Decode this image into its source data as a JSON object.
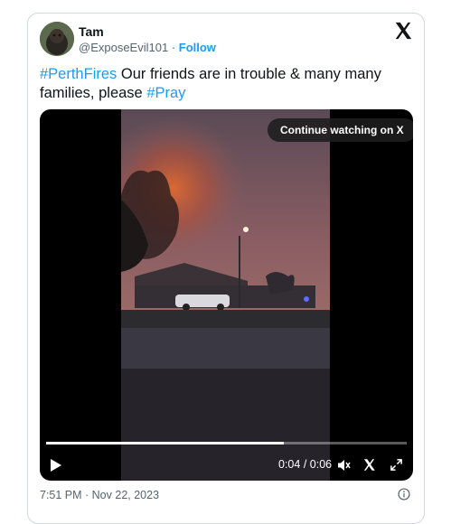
{
  "author": {
    "display_name": "Tam",
    "handle": "@ExposeEvil101",
    "separator": " · ",
    "follow_label": "Follow"
  },
  "tweet": {
    "hashtag1": "#PerthFires",
    "text1": " Our friends are in trouble & many many families, please ",
    "hashtag2": "#Pray"
  },
  "video": {
    "continue_label": "Continue watching on X",
    "time_current": "0:04",
    "time_separator": " / ",
    "time_total": "0:06",
    "progress": 0.66
  },
  "meta": {
    "timestamp": "7:51 PM · Nov 22, 2023"
  },
  "colors": {
    "accent": "#1d9bf0",
    "text": "#0f1419",
    "muted": "#536471"
  },
  "icons": [
    "x-logo-icon",
    "play-icon",
    "volume-icon",
    "x-watermark-icon",
    "fullscreen-icon",
    "info-icon"
  ]
}
